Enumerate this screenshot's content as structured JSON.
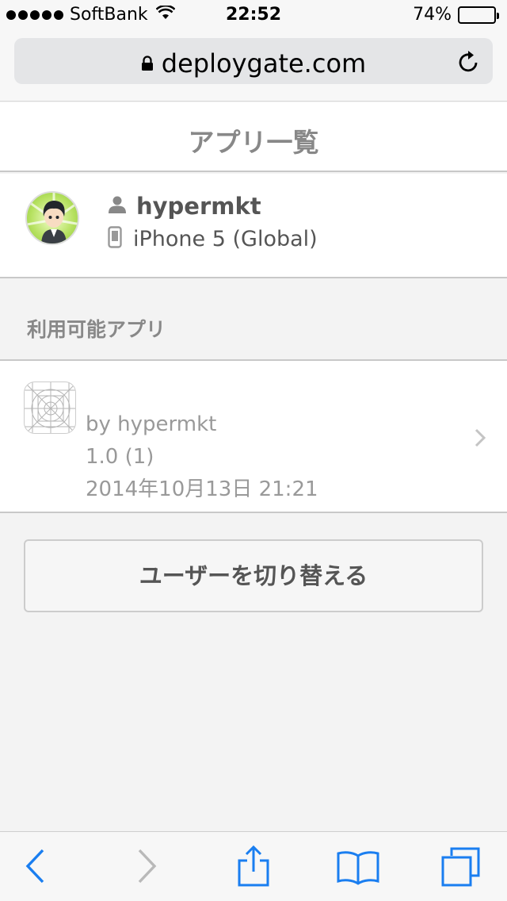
{
  "status_bar": {
    "carrier": "SoftBank",
    "time": "22:52",
    "battery_percent": "74%",
    "battery_level": 0.74
  },
  "address_bar": {
    "url": "deploygate.com"
  },
  "header": {
    "title": "アプリ一覧"
  },
  "user": {
    "name": "hypermkt",
    "device": "iPhone 5 (Global)"
  },
  "section": {
    "label": "利用可能アプリ"
  },
  "apps": [
    {
      "by": "by hypermkt",
      "version": "1.0 (1)",
      "date": "2014年10月13日 21:21"
    }
  ],
  "switch_user_label": "ユーザーを切り替える",
  "colors": {
    "toolbar_blue": "#1a7ef0",
    "toolbar_disabled": "#b9b9b9"
  }
}
